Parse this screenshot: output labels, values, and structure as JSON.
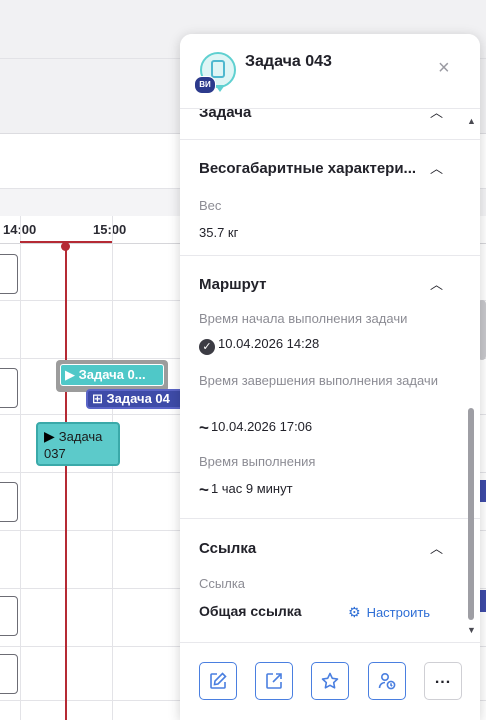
{
  "timeline": {
    "ticks": [
      "14:00",
      "15:00"
    ],
    "tasks": [
      {
        "label": "Задача 0..."
      },
      {
        "label": "Задача 04"
      },
      {
        "label": "Задача 037"
      }
    ]
  },
  "panel": {
    "avatar_badge": "ВИ",
    "title": "Задача 043",
    "close_icon": "×",
    "sections": {
      "task": {
        "title": "Задача"
      },
      "dims": {
        "title": "Весогабаритные характери...",
        "weight_label": "Вес",
        "weight_value": "35.7 кг"
      },
      "route": {
        "title": "Маршрут",
        "start_label": "Время начала выполнения задачи",
        "start_value": "10.04.2026 14:28",
        "end_label": "Время завершения выполнения задачи",
        "end_value": "10.04.2026 17:06",
        "duration_label": "Время выполнения",
        "duration_value": "1 час 9 минут"
      },
      "link": {
        "title": "Ссылка",
        "link_label": "Ссылка",
        "link_name": "Общая ссылка",
        "configure": "Настроить"
      }
    },
    "footer": {
      "more": "..."
    }
  },
  "colors": {
    "accent": "#4a7fe0",
    "now_line": "#b52a34",
    "task_teal": "#4fc8c8",
    "task_navy": "#3e4ba8"
  },
  "icons": [
    "edit-icon",
    "external-link-icon",
    "star-icon",
    "assign-user-icon",
    "more-icon",
    "gear-icon",
    "check-circle-icon",
    "approx-icon",
    "chevron-up-icon",
    "close-icon"
  ]
}
